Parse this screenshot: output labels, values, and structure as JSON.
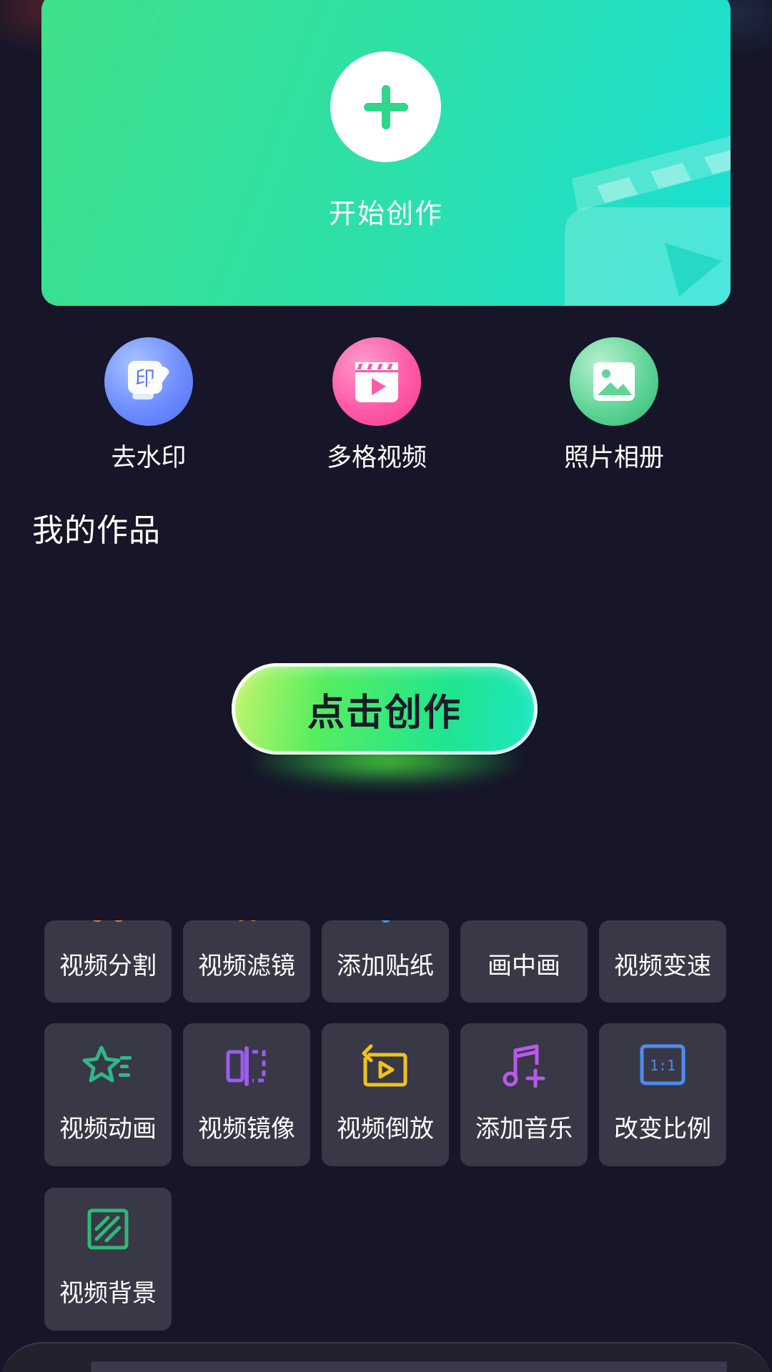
{
  "banner": {
    "label": "开始创作",
    "colors": {
      "start": "#3fe08a",
      "end": "#1adfd6"
    }
  },
  "quick_tools": [
    {
      "label": "去水印",
      "icon": "watermark-remove-icon",
      "color": "#6e8dff",
      "glyph": "印"
    },
    {
      "label": "多格视频",
      "icon": "video-clapper-icon",
      "color": "#ff5aa8"
    },
    {
      "label": "照片相册",
      "icon": "photo-album-icon",
      "color": "#60d597"
    }
  ],
  "my_works": {
    "title": "我的作品"
  },
  "create_button": {
    "label": "点击创作"
  },
  "tools_row1": [
    {
      "label": "视频分割"
    },
    {
      "label": "视频滤镜"
    },
    {
      "label": "添加贴纸"
    },
    {
      "label": "画中画"
    },
    {
      "label": "视频变速"
    }
  ],
  "tools_row2": [
    {
      "label": "视频动画",
      "icon": "star-animation-icon",
      "color": "#2fb88a"
    },
    {
      "label": "视频镜像",
      "icon": "mirror-icon",
      "color": "#9b5cf0"
    },
    {
      "label": "视频倒放",
      "icon": "reverse-play-icon",
      "color": "#f2c21a"
    },
    {
      "label": "添加音乐",
      "icon": "music-add-icon",
      "color": "#b65be8"
    },
    {
      "label": "改变比例",
      "icon": "aspect-ratio-icon",
      "color": "#4f8cf0",
      "glyph": "1:1"
    }
  ],
  "tools_row3": [
    {
      "label": "视频背景",
      "icon": "background-pattern-icon",
      "color": "#2fb877"
    }
  ],
  "peek_colors": [
    "#f08a3a",
    "#f08a3a",
    "#3aa0f0",
    "#2fb8a8",
    "#3a8cf0"
  ]
}
